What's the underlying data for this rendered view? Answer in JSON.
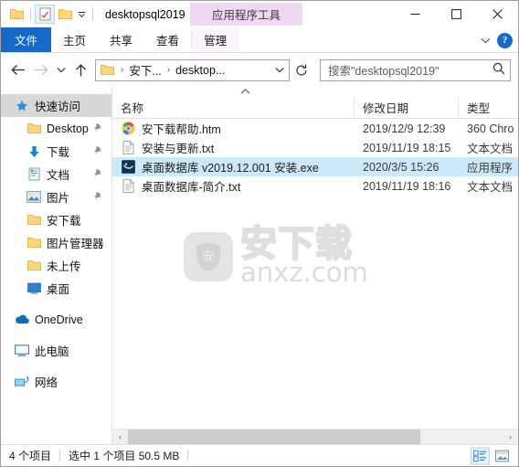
{
  "window": {
    "title": "desktopsql2019",
    "contextual_tab_header": "应用程序工具",
    "quick_access": [
      {
        "name": "folder-icon",
        "label": "文件夹"
      },
      {
        "name": "properties-icon",
        "label": "属性"
      },
      {
        "name": "new-folder-icon",
        "label": "新建文件夹"
      }
    ],
    "controls": {
      "minimize": "—",
      "maximize": "□",
      "close": "✕"
    }
  },
  "ribbon": {
    "tabs": [
      {
        "label": "文件",
        "active": true,
        "type": "file"
      },
      {
        "label": "主页",
        "active": false,
        "type": "normal"
      },
      {
        "label": "共享",
        "active": false,
        "type": "normal"
      },
      {
        "label": "查看",
        "active": false,
        "type": "normal"
      },
      {
        "label": "管理",
        "active": false,
        "type": "contextual"
      }
    ],
    "collapse_label": "⌄",
    "help_label": "?"
  },
  "address": {
    "back_label": "←",
    "forward_label": "→",
    "history_label": "⌄",
    "up_label": "↑",
    "breadcrumbs": [
      "安下...",
      "desktop..."
    ],
    "crumb_separator": "›",
    "dropdown_label": "⌄",
    "refresh_label": "↻",
    "search_value": "搜索\"desktopsql2019\"",
    "search_placeholder": "搜索\"desktopsql2019\"",
    "search_icon": "search-icon"
  },
  "sidebar": {
    "items": [
      {
        "label": "快速访问",
        "icon": "pin-star-icon",
        "level": "root",
        "selected": true,
        "pinned": false
      },
      {
        "label": "Desktop",
        "icon": "folder-icon",
        "level": "child",
        "selected": false,
        "pinned": true
      },
      {
        "label": "下载",
        "icon": "download-arrow-icon",
        "level": "child",
        "selected": false,
        "pinned": true
      },
      {
        "label": "文档",
        "icon": "documents-icon",
        "level": "child",
        "selected": false,
        "pinned": true
      },
      {
        "label": "图片",
        "icon": "pictures-icon",
        "level": "child",
        "selected": false,
        "pinned": true
      },
      {
        "label": "安下载",
        "icon": "folder-icon",
        "level": "child",
        "selected": false,
        "pinned": false
      },
      {
        "label": "图片管理器",
        "icon": "folder-icon",
        "level": "child",
        "selected": false,
        "pinned": false
      },
      {
        "label": "未上传",
        "icon": "folder-icon",
        "level": "child",
        "selected": false,
        "pinned": false
      },
      {
        "label": "桌面",
        "icon": "desktop-icon",
        "level": "child",
        "selected": false,
        "pinned": false
      }
    ],
    "roots": [
      {
        "label": "OneDrive",
        "icon": "onedrive-cloud-icon"
      },
      {
        "label": "此电脑",
        "icon": "this-pc-icon"
      },
      {
        "label": "网络",
        "icon": "network-icon"
      }
    ]
  },
  "filelist": {
    "sort_indicator": "⌃",
    "columns": [
      {
        "label": "名称",
        "key": "name"
      },
      {
        "label": "修改日期",
        "key": "date"
      },
      {
        "label": "类型",
        "key": "type"
      }
    ],
    "rows": [
      {
        "name": "安下载帮助.htm",
        "date": "2019/12/9 12:39",
        "type": "360 Chro",
        "icon": "chrome-html-icon",
        "selected": false
      },
      {
        "name": "安装与更新.txt",
        "date": "2019/11/19 18:15",
        "type": "文本文档",
        "icon": "text-file-icon",
        "selected": false
      },
      {
        "name": "桌面数据库 v2019.12.001 安装.exe",
        "date": "2020/3/5 15:26",
        "type": "应用程序",
        "icon": "application-icon",
        "selected": true
      },
      {
        "name": "桌面数据库-简介.txt",
        "date": "2019/11/19 18:16",
        "type": "文本文档",
        "icon": "text-file-icon",
        "selected": false
      }
    ]
  },
  "watermark": {
    "chinese": "安下载",
    "english": "anxz.com",
    "shield_glyph": "安"
  },
  "scrollbar": {
    "left_arrow": "‹",
    "right_arrow": "›",
    "thumb_percent": 78
  },
  "statusbar": {
    "item_count": "4 个项目",
    "selection": "选中 1 个项目  50.5 MB",
    "views": [
      {
        "name": "details-view-button",
        "active": true
      },
      {
        "name": "large-icons-view-button",
        "active": false
      }
    ]
  },
  "colors": {
    "accent": "#1569c7",
    "selection": "#cde8f9",
    "contextual": "#f0d8f2",
    "folder": "#fcd77a"
  }
}
